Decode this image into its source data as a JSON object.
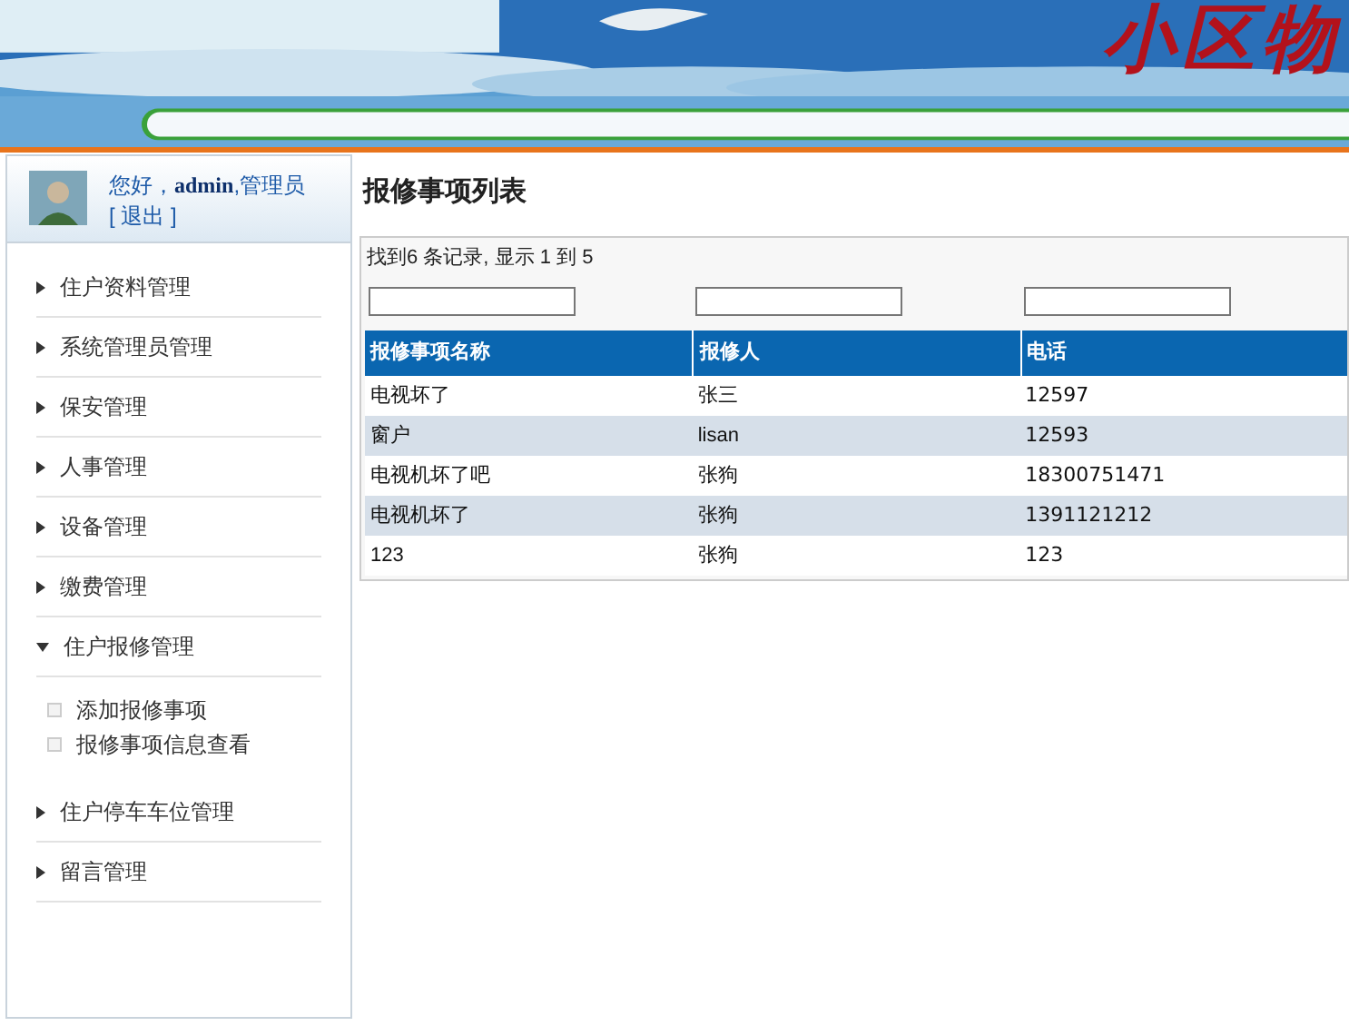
{
  "header": {
    "title": "小区物"
  },
  "user": {
    "greeting": "您好，",
    "name": "admin",
    "role": ",管理员",
    "logout": "[ 退出 ]"
  },
  "menu": [
    {
      "label": "住户资料管理",
      "expanded": false
    },
    {
      "label": "系统管理员管理",
      "expanded": false
    },
    {
      "label": "保安管理",
      "expanded": false
    },
    {
      "label": "人事管理",
      "expanded": false
    },
    {
      "label": "设备管理",
      "expanded": false
    },
    {
      "label": "缴费管理",
      "expanded": false
    },
    {
      "label": "住户报修管理",
      "expanded": true,
      "children": [
        {
          "label": "添加报修事项"
        },
        {
          "label": "报修事项信息查看"
        }
      ]
    },
    {
      "label": "住户停车车位管理",
      "expanded": false
    },
    {
      "label": "留言管理",
      "expanded": false
    }
  ],
  "page": {
    "title": "报修事项列表",
    "summary": "找到6 条记录, 显示 1 到 5"
  },
  "table": {
    "columns": [
      "报修事项名称",
      "报修人",
      "电话"
    ],
    "rows": [
      [
        "电视坏了",
        "张三",
        "12597"
      ],
      [
        "窗户",
        "lisan",
        "12593"
      ],
      [
        "电视机坏了吧",
        "张狗",
        "18300751471"
      ],
      [
        "电视机坏了",
        "张狗",
        "1391121212"
      ],
      [
        "123",
        "张狗",
        "123"
      ]
    ]
  }
}
